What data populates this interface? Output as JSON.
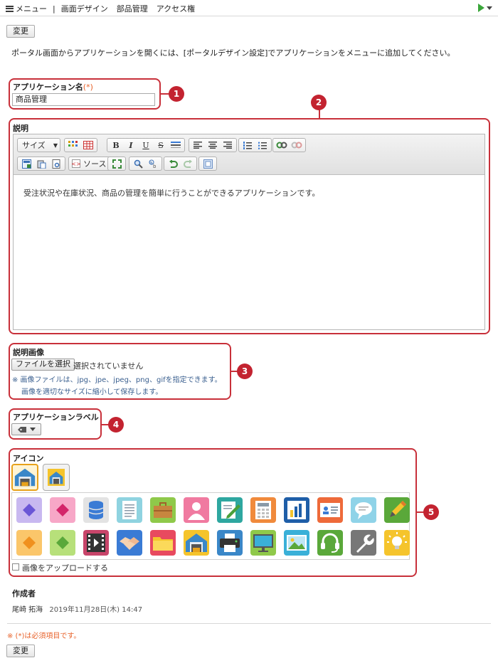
{
  "topbar": {
    "menu_label": "メニュー",
    "separator": "|",
    "breadcrumbs": [
      "画面デザイン",
      "部品管理",
      "アクセス権"
    ]
  },
  "buttons": {
    "change_top": "変更",
    "change_bottom": "変更"
  },
  "note": "ポータル画面からアプリケーションを開くには、[ポータルデザイン設定]でアプリケーションをメニューに追加してください。",
  "app_name": {
    "label": "アプリケーション名",
    "required_mark": "(*)",
    "value": "商品管理"
  },
  "description": {
    "label": "説明",
    "size_label": "サイズ",
    "source_label": "ソース",
    "text": "受注状況や在庫状況、商品の管理を簡単に行うことができるアプリケーションです。"
  },
  "desc_image": {
    "label": "説明画像",
    "file_button": "ファイルを選択",
    "file_status": "選択されていません",
    "hint1": "※ 画像ファイルは、jpg、jpe、jpeg、png、gifを指定できます。",
    "hint2": "画像を適切なサイズに縮小して保存します。"
  },
  "app_label": {
    "label": "アプリケーションラベル"
  },
  "icon": {
    "label": "アイコン",
    "upload_label": "画像をアップロードする"
  },
  "creator": {
    "label": "作成者",
    "name": "尾崎 拓海",
    "date": "2019年11月28日(木) 14:47"
  },
  "footer_note": "※ (*)は必須項目です。",
  "markers": [
    "1",
    "2",
    "3",
    "4",
    "5"
  ],
  "colors": {
    "accent_red": "#c8303a",
    "required_orange": "#e8622a",
    "hint_blue": "#3a5f8f"
  }
}
